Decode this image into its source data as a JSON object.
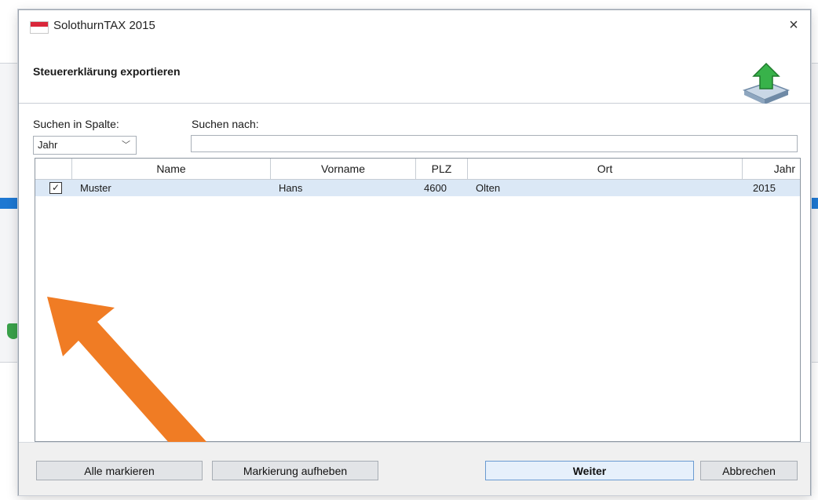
{
  "window": {
    "title": "SolothurnTAX 2015",
    "close_glyph": "×",
    "icon": "swiss-flag-icon"
  },
  "header": {
    "title": "Steuererklärung exportieren",
    "icon": "export-upload-icon"
  },
  "filter": {
    "column_label": "Suchen in Spalte:",
    "column_value": "Jahr",
    "search_label": "Suchen nach:",
    "search_value": ""
  },
  "table": {
    "columns": [
      "Name",
      "Vorname",
      "PLZ",
      "Ort",
      "Jahr"
    ],
    "rows": [
      {
        "checked": true,
        "name": "Muster",
        "vorname": "Hans",
        "plz": "4600",
        "ort": "Olten",
        "jahr": "2015"
      }
    ]
  },
  "buttons": {
    "select_all": "Alle markieren",
    "clear_selection": "Markierung aufheben",
    "next": "Weiter",
    "cancel": "Abbrechen"
  },
  "colors": {
    "accent": "#1e78d2",
    "annotation_arrow": "#f07c24",
    "row_highlight": "#dbe8f6"
  }
}
